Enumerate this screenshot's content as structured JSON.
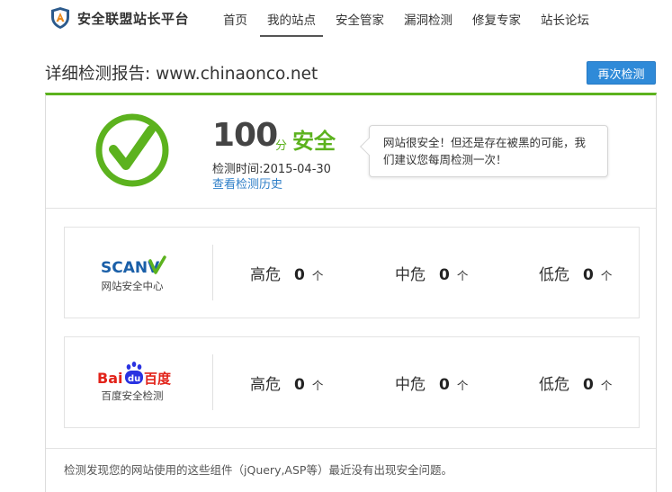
{
  "site": {
    "brand": "安全联盟站长平台"
  },
  "nav": {
    "items": [
      {
        "label": "首页",
        "active": false
      },
      {
        "label": "我的站点",
        "active": true
      },
      {
        "label": "安全管家",
        "active": false
      },
      {
        "label": "漏洞检测",
        "active": false
      },
      {
        "label": "修复专家",
        "active": false
      },
      {
        "label": "站长论坛",
        "active": false
      }
    ]
  },
  "report": {
    "title": "详细检测报告:  www.chinaonco.net",
    "recheck_label": "再次检测",
    "score": "100",
    "score_unit": "分",
    "status": "安全",
    "scan_time": "检测时间:2015-04-30",
    "history_link": "查看检测历史",
    "message": "网站很安全！但还是存在被黑的可能，我们建议您每周检测一次！"
  },
  "engines": [
    {
      "logo_text": "SCANV",
      "name": "网站安全中心",
      "risks": [
        {
          "label": "高危",
          "count": "0",
          "unit": "个"
        },
        {
          "label": "中危",
          "count": "0",
          "unit": "个"
        },
        {
          "label": "低危",
          "count": "0",
          "unit": "个"
        }
      ]
    },
    {
      "logo_text_1": "Bai",
      "logo_text_2": "du",
      "logo_text_3": "百度",
      "name": "百度安全检测",
      "risks": [
        {
          "label": "高危",
          "count": "0",
          "unit": "个"
        },
        {
          "label": "中危",
          "count": "0",
          "unit": "个"
        },
        {
          "label": "低危",
          "count": "0",
          "unit": "个"
        }
      ]
    }
  ],
  "footer": {
    "note": "检测发现您的网站使用的这些组件（jQuery,ASP等）最近没有出现安全问题。"
  },
  "colors": {
    "accent_green": "#5cb21e",
    "button_blue": "#2f8ad8",
    "link_blue": "#2f7fc8",
    "scanv_blue": "#1a5fa8",
    "baidu_red": "#e2231a",
    "baidu_blue": "#2932e1"
  }
}
